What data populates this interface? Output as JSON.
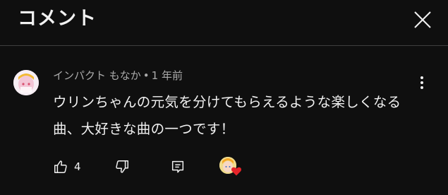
{
  "header": {
    "title": "コメント"
  },
  "comment": {
    "author": "インパクト もなか",
    "separator": "•",
    "time": "1 年前",
    "text": "ウリンちゃんの元気を分けてもらえるような楽しくなる曲、大好きな曲の一つです！",
    "like_count": "4"
  },
  "colors": {
    "background": "#0f0f0f",
    "text_primary": "#f1f1f1",
    "text_secondary": "#aaaaaa",
    "heart": "#e5242a"
  }
}
